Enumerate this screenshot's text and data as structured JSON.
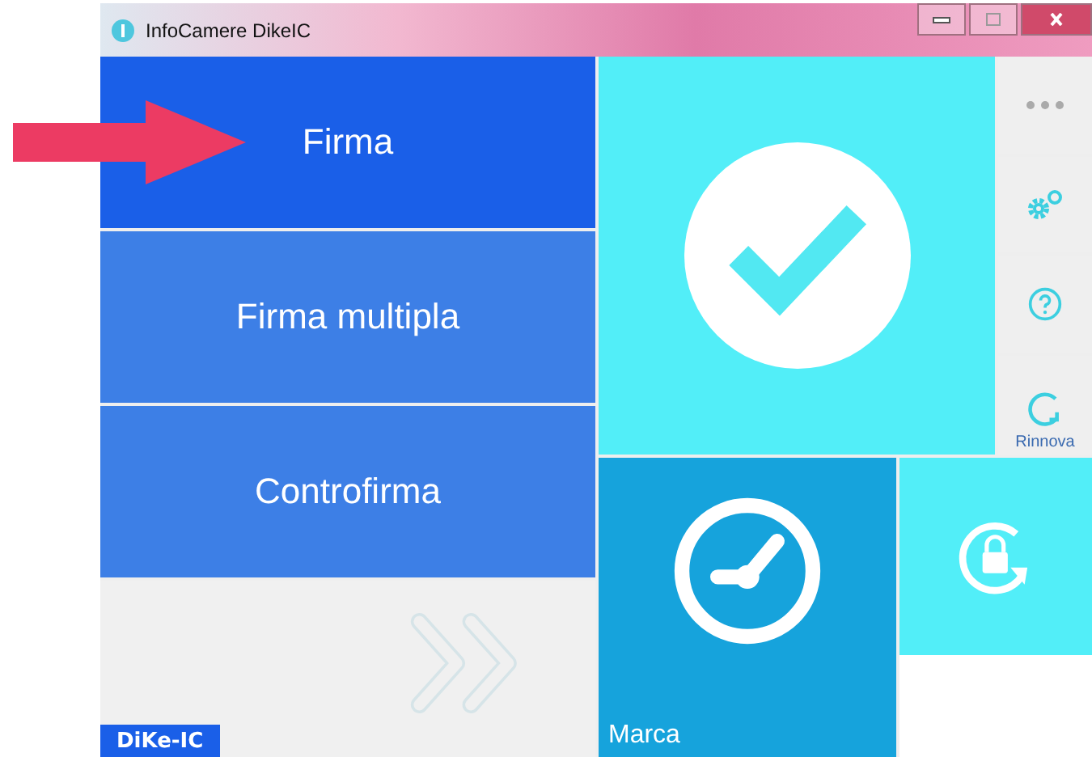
{
  "window": {
    "title": "InfoCamere DikeIC"
  },
  "actions": [
    {
      "label": "Firma",
      "selected": true
    },
    {
      "label": "Firma multipla",
      "selected": false
    },
    {
      "label": "Controfirma",
      "selected": false
    }
  ],
  "brand_badge": "DiKe-IC",
  "side_buttons": [
    {
      "kind": "more"
    },
    {
      "kind": "settings"
    },
    {
      "kind": "help"
    },
    {
      "kind": "renew",
      "label": "Rinnova"
    }
  ],
  "tiles": [
    {
      "kind": "verify"
    },
    {
      "kind": "timestamp",
      "label": "Marca"
    },
    {
      "kind": "unlock"
    }
  ]
}
